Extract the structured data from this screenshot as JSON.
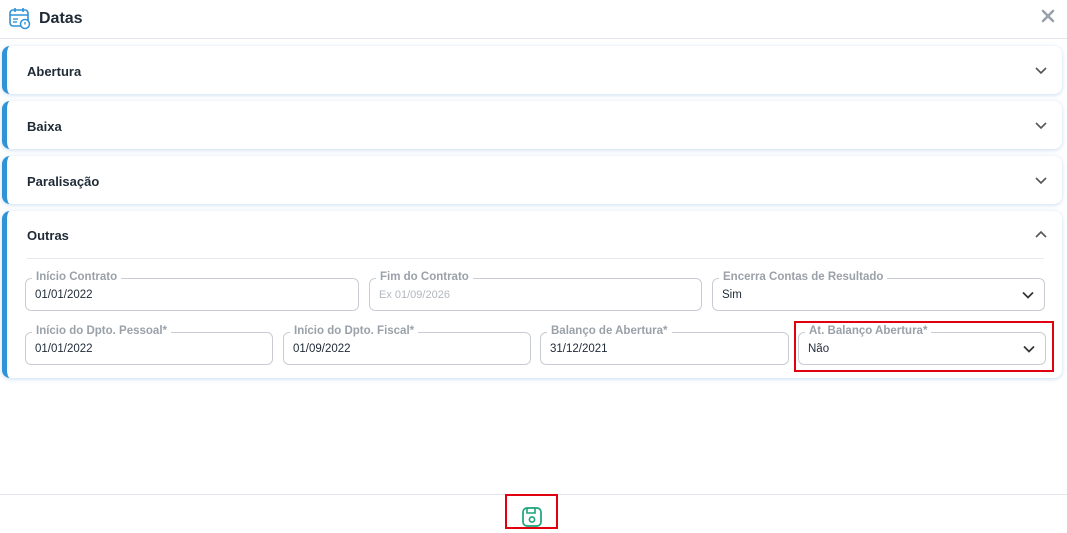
{
  "header": {
    "title": "Datas",
    "icon": "calendar-icon",
    "close_icon": "close-icon"
  },
  "panels": [
    {
      "label": "Abertura",
      "state": "collapsed"
    },
    {
      "label": "Baixa",
      "state": "collapsed"
    },
    {
      "label": "Paralisação",
      "state": "collapsed"
    },
    {
      "label": "Outras",
      "state": "expanded"
    }
  ],
  "outras": {
    "inicio_contrato": {
      "label": "Início Contrato",
      "value": "01/01/2022"
    },
    "fim_contrato": {
      "label": "Fim do Contrato",
      "placeholder": "Ex 01/09/2026"
    },
    "encerra_contas": {
      "label": "Encerra Contas de Resultado",
      "value": "Sim"
    },
    "inicio_pessoal": {
      "label": "Início do Dpto. Pessoal*",
      "value": "01/01/2022"
    },
    "inicio_fiscal": {
      "label": "Início do Dpto. Fiscal*",
      "value": "01/09/2022"
    },
    "balanco_abertura": {
      "label": "Balanço de Abertura*",
      "value": "31/12/2021"
    },
    "at_balanco": {
      "label": "At. Balanço Abertura*",
      "value": "Não"
    }
  },
  "footer": {
    "save_icon": "save-icon"
  },
  "colors": {
    "accent": "#2f93d6",
    "highlight": "#e0000f",
    "save": "#1aa37a"
  }
}
